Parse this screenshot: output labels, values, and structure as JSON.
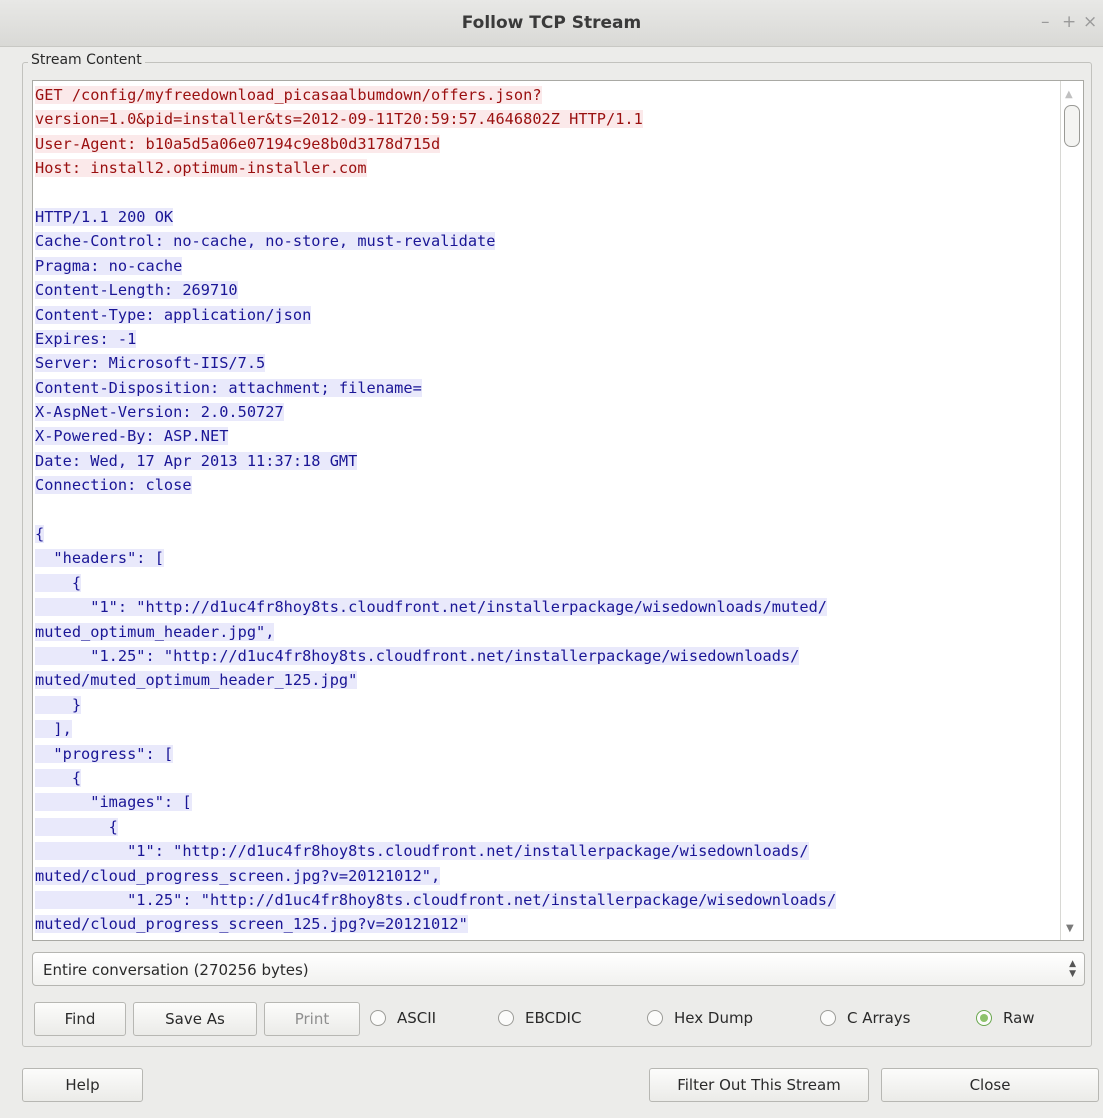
{
  "window": {
    "title": "Follow TCP Stream",
    "controls": [
      "–",
      "+",
      "×"
    ]
  },
  "stream_content": {
    "label": "Stream Content",
    "lines": [
      {
        "speaker": "client",
        "text": "GET /config/myfreedownload_picasaalbumdown/offers.json?"
      },
      {
        "speaker": "client",
        "text": "version=1.0&pid=installer&ts=2012-09-11T20:59:57.4646802Z HTTP/1.1"
      },
      {
        "speaker": "client",
        "text": "User-Agent: b10a5d5a06e07194c9e8b0d3178d715d"
      },
      {
        "speaker": "client",
        "text": "Host: install2.optimum-installer.com"
      },
      {
        "speaker": "blank",
        "text": ""
      },
      {
        "speaker": "server",
        "text": "HTTP/1.1 200 OK"
      },
      {
        "speaker": "server",
        "text": "Cache-Control: no-cache, no-store, must-revalidate"
      },
      {
        "speaker": "server",
        "text": "Pragma: no-cache"
      },
      {
        "speaker": "server",
        "text": "Content-Length: 269710"
      },
      {
        "speaker": "server",
        "text": "Content-Type: application/json"
      },
      {
        "speaker": "server",
        "text": "Expires: -1"
      },
      {
        "speaker": "server",
        "text": "Server: Microsoft-IIS/7.5"
      },
      {
        "speaker": "server",
        "text": "Content-Disposition: attachment; filename="
      },
      {
        "speaker": "server",
        "text": "X-AspNet-Version: 2.0.50727"
      },
      {
        "speaker": "server",
        "text": "X-Powered-By: ASP.NET"
      },
      {
        "speaker": "server",
        "text": "Date: Wed, 17 Apr 2013 11:37:18 GMT"
      },
      {
        "speaker": "server",
        "text": "Connection: close"
      },
      {
        "speaker": "blank",
        "text": ""
      },
      {
        "speaker": "server",
        "text": "{"
      },
      {
        "speaker": "server",
        "text": "  \"headers\": ["
      },
      {
        "speaker": "server",
        "text": "    {"
      },
      {
        "speaker": "server",
        "text": "      \"1\": \"http://d1uc4fr8hoy8ts.cloudfront.net/installerpackage/wisedownloads/muted/"
      },
      {
        "speaker": "server",
        "text": "muted_optimum_header.jpg\","
      },
      {
        "speaker": "server",
        "text": "      \"1.25\": \"http://d1uc4fr8hoy8ts.cloudfront.net/installerpackage/wisedownloads/"
      },
      {
        "speaker": "server",
        "text": "muted/muted_optimum_header_125.jpg\""
      },
      {
        "speaker": "server",
        "text": "    }"
      },
      {
        "speaker": "server",
        "text": "  ],"
      },
      {
        "speaker": "server",
        "text": "  \"progress\": ["
      },
      {
        "speaker": "server",
        "text": "    {"
      },
      {
        "speaker": "server",
        "text": "      \"images\": ["
      },
      {
        "speaker": "server",
        "text": "        {"
      },
      {
        "speaker": "server",
        "text": "          \"1\": \"http://d1uc4fr8hoy8ts.cloudfront.net/installerpackage/wisedownloads/"
      },
      {
        "speaker": "server",
        "text": "muted/cloud_progress_screen.jpg?v=20121012\","
      },
      {
        "speaker": "server",
        "text": "          \"1.25\": \"http://d1uc4fr8hoy8ts.cloudfront.net/installerpackage/wisedownloads/"
      },
      {
        "speaker": "server",
        "text": "muted/cloud_progress_screen_125.jpg?v=20121012\""
      }
    ]
  },
  "conversation_select": {
    "selected": "Entire conversation (270256 bytes)"
  },
  "toolbar": {
    "find_label": "Find",
    "save_as_label": "Save As",
    "print_label": "Print"
  },
  "formats": [
    {
      "label": "ASCII",
      "checked": false
    },
    {
      "label": "EBCDIC",
      "checked": false
    },
    {
      "label": "Hex Dump",
      "checked": false
    },
    {
      "label": "C Arrays",
      "checked": false
    },
    {
      "label": "Raw",
      "checked": true
    }
  ],
  "footer": {
    "help_label": "Help",
    "filter_label": "Filter Out This Stream",
    "close_label": "Close"
  },
  "colors": {
    "client_text": "#9a0f0f",
    "client_bg": "#fbe9ea",
    "server_text": "#1a1696",
    "server_bg": "#e9e9fb",
    "raw_radio": "#8dc26b"
  }
}
